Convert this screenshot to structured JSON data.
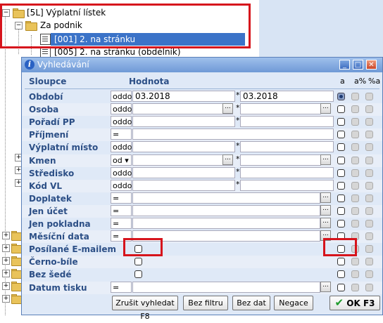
{
  "tree": {
    "top_partial": "",
    "items": [
      {
        "label": "[5L] Výplatní lístek",
        "expander": "−"
      },
      {
        "label": "Za podnik",
        "expander": "−"
      },
      {
        "label": "[001] 2. na stránku"
      },
      {
        "label": "[005] 2. na stránku (obdélník)"
      }
    ],
    "left_expanders": [
      "+",
      "+",
      "+",
      "+",
      "+",
      "+",
      "+",
      "+",
      "+"
    ]
  },
  "dialog": {
    "title": "Vyhledávání",
    "header_column": "Sloupce",
    "header_value": "Hodnota",
    "header_a": "a",
    "header_apct": "a%",
    "header_pcta": "%a",
    "rows": [
      {
        "label": "Období",
        "op": "oddo",
        "val1": "03.2018",
        "star": "*",
        "val2": "03.2018",
        "dots1": false,
        "dots2": false,
        "a": "selected"
      },
      {
        "label": "Osoba",
        "op": "oddo",
        "val1": "",
        "star": "*",
        "val2": "",
        "dots1": true,
        "dots2": true,
        "a": "on"
      },
      {
        "label": "Pořadí PP",
        "op": "oddo",
        "val1": "",
        "star": "*",
        "val2": "",
        "dots1": false,
        "dots2": false,
        "a": "on"
      },
      {
        "label": "Příjmení",
        "op": "=",
        "val1": "",
        "star": "",
        "val2": "",
        "dots1": false,
        "dots2": false,
        "a": "on"
      },
      {
        "label": "Výplatní místo",
        "op": "oddo",
        "val1": "",
        "star": "*",
        "val2": "",
        "dots1": false,
        "dots2": false,
        "a": "on"
      },
      {
        "label": "Kmen",
        "op": "od ▾",
        "val1": "",
        "star": "*",
        "val2": "",
        "dots1": true,
        "dots2": true,
        "a": "on"
      },
      {
        "label": "Středisko",
        "op": "oddo",
        "val1": "",
        "star": "*",
        "val2": "",
        "dots1": false,
        "dots2": false,
        "a": "on"
      },
      {
        "label": "Kód VL",
        "op": "oddo",
        "val1": "",
        "star": "*",
        "val2": "",
        "dots1": false,
        "dots2": false,
        "a": "on"
      },
      {
        "label": "Doplatek",
        "op": "=",
        "val1": "",
        "star": "",
        "val2": "",
        "dots1": false,
        "dots2": true,
        "a": "on"
      },
      {
        "label": "Jen účet",
        "op": "=",
        "val1": "",
        "star": "",
        "val2": "",
        "dots1": false,
        "dots2": true,
        "a": "on"
      },
      {
        "label": "Jen pokladna",
        "op": "=",
        "val1": "",
        "star": "",
        "val2": "",
        "dots1": false,
        "dots2": true,
        "a": "on"
      },
      {
        "label": "Měsíční data",
        "op": "=",
        "val1": "",
        "star": "",
        "val2": "",
        "dots1": false,
        "dots2": true,
        "a": "on"
      },
      {
        "label": "Posílané E-mailem",
        "checkbox": true,
        "a": "on"
      },
      {
        "label": "Černo-bíle",
        "checkbox": true,
        "a": "on"
      },
      {
        "label": "Bez šedé",
        "checkbox": true,
        "a": "on"
      },
      {
        "label": "Datum tisku",
        "op": "=",
        "val1": "",
        "star": "",
        "val2": "",
        "dots1": false,
        "dots2": true,
        "a": "on"
      }
    ],
    "buttons": {
      "cancel_search": "Zrušit vyhledat F8",
      "no_filter": "Bez filtru",
      "no_data": "Bez dat",
      "negate": "Negace",
      "ok": "OK F3"
    }
  },
  "colors": {
    "highlight_red": "#d6141c",
    "selection_blue": "#3b73c8",
    "dialog_bg": "#dfe9f7",
    "label_blue": "#2c4f86"
  }
}
